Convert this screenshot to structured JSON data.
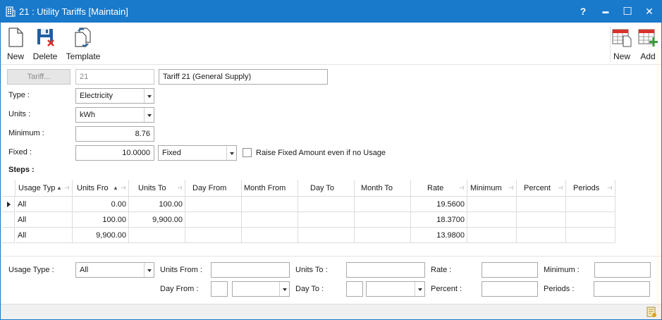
{
  "window": {
    "title": "21 : Utility Tariffs [Maintain]",
    "help": "?",
    "minimize": "▬",
    "maximize": "☐",
    "close": "✕"
  },
  "toolbar": {
    "left": [
      {
        "label": "New",
        "icon": "new-document-icon"
      },
      {
        "label": "Delete",
        "icon": "save-delete-icon"
      },
      {
        "label": "Template",
        "icon": "template-icon"
      }
    ],
    "right": [
      {
        "label": "New",
        "icon": "new-grid-icon"
      },
      {
        "label": "Add",
        "icon": "add-grid-icon"
      }
    ]
  },
  "form": {
    "tariff_button": "Tariff...",
    "tariff_code": "21",
    "tariff_name": "Tariff 21 (General Supply)",
    "type_label": "Type :",
    "type_value": "Electricity",
    "units_label": "Units :",
    "units_value": "kWh",
    "minimum_label": "Minimum :",
    "minimum_value": "8.76",
    "fixed_label": "Fixed :",
    "fixed_value": "10.0000",
    "fixed_mode": "Fixed",
    "raise_fixed_label": "Raise Fixed Amount even if no Usage",
    "steps_label": "Steps :"
  },
  "grid": {
    "columns": [
      "Usage Typ",
      "Units Fro",
      "Units To",
      "Day From",
      "Month From",
      "Day To",
      "Month To",
      "Rate",
      "Minimum",
      "Percent",
      "Periods"
    ],
    "rows": [
      [
        "All",
        "0.00",
        "100.00",
        "",
        "",
        "",
        "",
        "19.5600",
        "",
        "",
        ""
      ],
      [
        "All",
        "100.00",
        "9,900.00",
        "",
        "",
        "",
        "",
        "18.3700",
        "",
        "",
        ""
      ],
      [
        "All",
        "9,900.00",
        "",
        "",
        "",
        "",
        "",
        "13.9800",
        "",
        "",
        ""
      ]
    ]
  },
  "editor": {
    "usage_type_label": "Usage Type :",
    "usage_type_value": "All",
    "units_from_label": "Units From :",
    "units_from_value": "",
    "units_to_label": "Units To :",
    "units_to_value": "",
    "rate_label": "Rate :",
    "rate_value": "",
    "minimum_label": "Minimum :",
    "minimum_value": "",
    "day_from_label": "Day From :",
    "day_to_label": "Day To :",
    "percent_label": "Percent :",
    "percent_value": "",
    "periods_label": "Periods :",
    "periods_value": ""
  },
  "colors": {
    "titlebar": "#1979ca",
    "accent_red": "#d9322b",
    "accent_green": "#3a9a3a"
  }
}
